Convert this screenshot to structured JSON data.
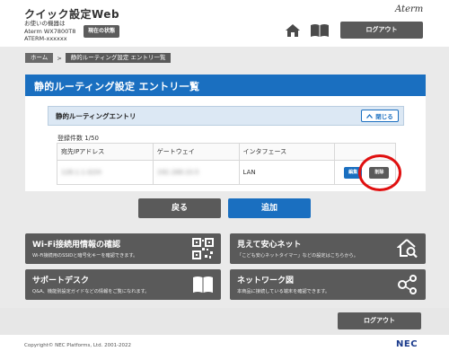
{
  "header": {
    "app_title": "クイック設定Web",
    "device_label": "お使いの機器は",
    "device_model": "Aterm WX7800T8",
    "device_id": "ATERM-xxxxxx",
    "status_button": "現在の状態",
    "brand": "Aterm",
    "logout": "ログアウト"
  },
  "breadcrumb": {
    "home": "ホーム",
    "separator": ">",
    "current": "静的ルーティング設定 エントリ一覧"
  },
  "page": {
    "title": "静的ルーティング設定 エントリ一覧"
  },
  "entry_section": {
    "title": "静的ルーティングエントリ",
    "close_button": "閉じる",
    "count": "登録件数 1/50",
    "columns": [
      "宛先IPアドレス",
      "ゲートウェイ",
      "インタフェース",
      ""
    ],
    "rows": [
      {
        "dest_ip": "128.1.1.0/24",
        "gateway": "192.168.10.5",
        "interface": "LAN",
        "edit": "編集",
        "delete": "削除"
      }
    ]
  },
  "actions": {
    "back": "戻る",
    "add": "追加"
  },
  "tiles": [
    {
      "title": "Wi-Fi接続用情報の確認",
      "desc": "Wi-Fi接続用のSSIDと暗号化キーを確認できます。",
      "icon": "qr-code-icon"
    },
    {
      "title": "見えて安心ネット",
      "desc": "「こども安心ネットタイマー」などの設定はこちらから。",
      "icon": "home-search-icon"
    },
    {
      "title": "サポートデスク",
      "desc": "Q&A、機能別設定ガイドなどの情報をご覧になれます。",
      "icon": "book-icon"
    },
    {
      "title": "ネットワーク図",
      "desc": "本商品に接続している端末を確認できます。",
      "icon": "network-icon"
    }
  ],
  "footer": {
    "logout": "ログアウト",
    "copyright": "Copyright© NEC Platforms, Ltd. 2001-2022",
    "logo": "NEC"
  },
  "colors": {
    "accent_blue": "#1a6fc0",
    "button_gray": "#5a5a5a",
    "highlight_red": "#e01010"
  }
}
